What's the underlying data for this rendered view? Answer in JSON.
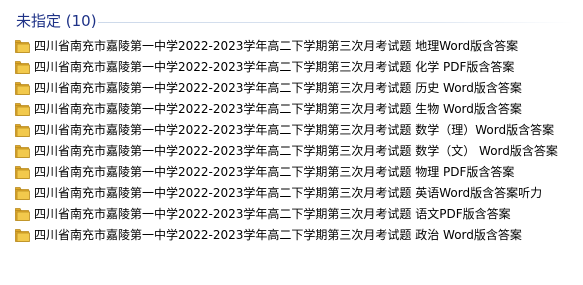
{
  "group": {
    "title": "未指定 (10)"
  },
  "files": [
    {
      "name": "四川省南充市嘉陵第一中学2022-2023学年高二下学期第三次月考试题 地理Word版含答案",
      "icon": "folder-icon"
    },
    {
      "name": "四川省南充市嘉陵第一中学2022-2023学年高二下学期第三次月考试题 化学 PDF版含答案",
      "icon": "folder-icon"
    },
    {
      "name": "四川省南充市嘉陵第一中学2022-2023学年高二下学期第三次月考试题 历史 Word版含答案",
      "icon": "folder-icon"
    },
    {
      "name": "四川省南充市嘉陵第一中学2022-2023学年高二下学期第三次月考试题 生物 Word版含答案",
      "icon": "folder-icon"
    },
    {
      "name": "四川省南充市嘉陵第一中学2022-2023学年高二下学期第三次月考试题 数学（理）Word版含答案",
      "icon": "folder-icon"
    },
    {
      "name": "四川省南充市嘉陵第一中学2022-2023学年高二下学期第三次月考试题 数学（文） Word版含答案",
      "icon": "folder-icon"
    },
    {
      "name": "四川省南充市嘉陵第一中学2022-2023学年高二下学期第三次月考试题 物理 PDF版含答案",
      "icon": "folder-icon"
    },
    {
      "name": "四川省南充市嘉陵第一中学2022-2023学年高二下学期第三次月考试题 英语Word版含答案听力",
      "icon": "folder-icon"
    },
    {
      "name": "四川省南充市嘉陵第一中学2022-2023学年高二下学期第三次月考试题 语文PDF版含答案",
      "icon": "folder-icon"
    },
    {
      "name": "四川省南充市嘉陵第一中学2022-2023学年高二下学期第三次月考试题 政治 Word版含答案",
      "icon": "folder-icon"
    }
  ],
  "colors": {
    "group_title": "#1e3287",
    "folder_body": "#f2c94c",
    "folder_tab": "#e0a92a",
    "folder_edge": "#b88a1e"
  }
}
